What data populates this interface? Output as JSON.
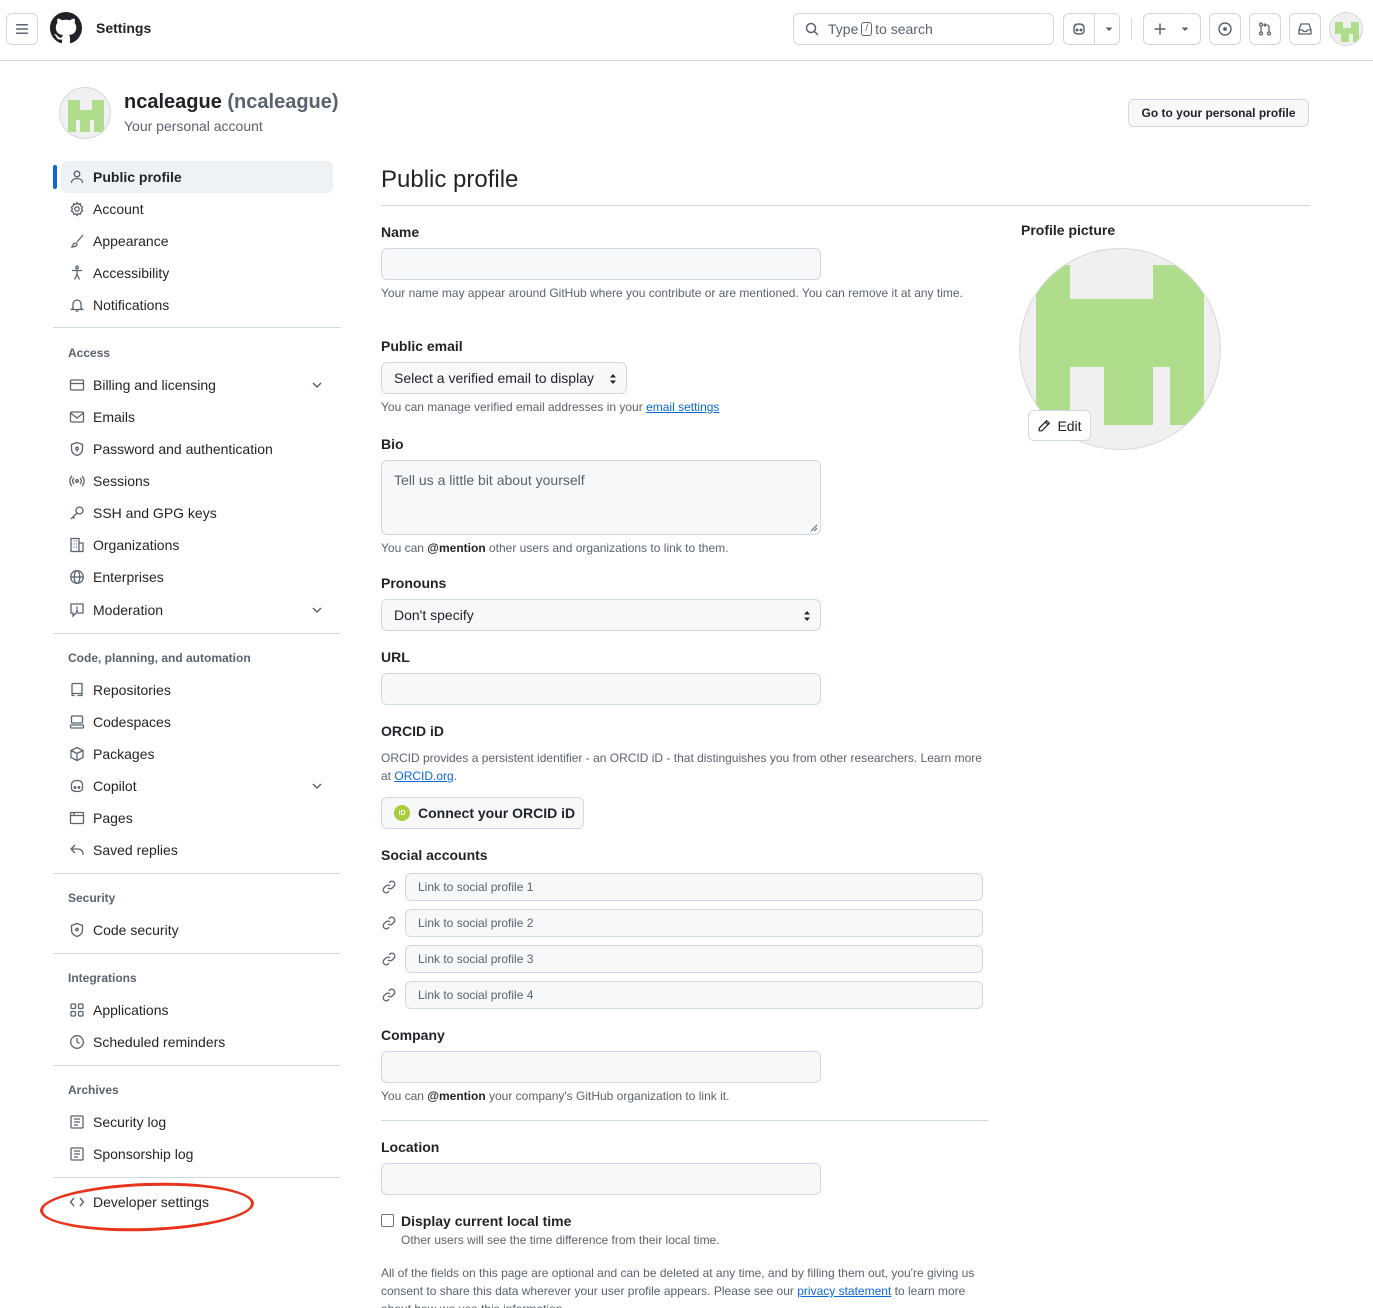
{
  "header": {
    "title": "Settings",
    "search_prefix": "Type",
    "search_key": "/",
    "search_suffix": "to search"
  },
  "account": {
    "name": "ncaleague",
    "handle": "(ncaleague)",
    "subtitle": "Your personal account",
    "profile_button": "Go to your personal profile"
  },
  "sidebar": {
    "top": [
      {
        "label": "Public profile",
        "icon": "person-icon",
        "active": true
      },
      {
        "label": "Account",
        "icon": "gear-icon"
      },
      {
        "label": "Appearance",
        "icon": "paintbrush-icon"
      },
      {
        "label": "Accessibility",
        "icon": "accessibility-icon"
      },
      {
        "label": "Notifications",
        "icon": "bell-icon"
      }
    ],
    "access_heading": "Access",
    "access": [
      {
        "label": "Billing and licensing",
        "icon": "credit-card-icon",
        "expandable": true
      },
      {
        "label": "Emails",
        "icon": "mail-icon"
      },
      {
        "label": "Password and authentication",
        "icon": "shield-lock-icon"
      },
      {
        "label": "Sessions",
        "icon": "broadcast-icon"
      },
      {
        "label": "SSH and GPG keys",
        "icon": "key-icon"
      },
      {
        "label": "Organizations",
        "icon": "organization-icon"
      },
      {
        "label": "Enterprises",
        "icon": "globe-icon"
      },
      {
        "label": "Moderation",
        "icon": "report-icon",
        "expandable": true
      }
    ],
    "code_heading": "Code, planning, and automation",
    "code": [
      {
        "label": "Repositories",
        "icon": "repo-icon"
      },
      {
        "label": "Codespaces",
        "icon": "codespaces-icon"
      },
      {
        "label": "Packages",
        "icon": "package-icon"
      },
      {
        "label": "Copilot",
        "icon": "copilot-icon",
        "expandable": true
      },
      {
        "label": "Pages",
        "icon": "browser-icon"
      },
      {
        "label": "Saved replies",
        "icon": "reply-icon"
      }
    ],
    "security_heading": "Security",
    "security": [
      {
        "label": "Code security",
        "icon": "shield-icon"
      }
    ],
    "integrations_heading": "Integrations",
    "integrations": [
      {
        "label": "Applications",
        "icon": "apps-icon"
      },
      {
        "label": "Scheduled reminders",
        "icon": "clock-icon"
      }
    ],
    "archives_heading": "Archives",
    "archives": [
      {
        "label": "Security log",
        "icon": "log-icon"
      },
      {
        "label": "Sponsorship log",
        "icon": "log-icon"
      }
    ],
    "developer": {
      "label": "Developer settings",
      "icon": "code-icon"
    }
  },
  "main": {
    "title": "Public profile",
    "name_label": "Name",
    "name_value": "",
    "name_note": "Your name may appear around GitHub where you contribute or are mentioned. You can remove it at any time.",
    "email_label": "Public email",
    "email_select": "Select a verified email to display",
    "email_note_prefix": "You can manage verified email addresses in your",
    "email_note_link": "email settings",
    "bio_label": "Bio",
    "bio_placeholder": "Tell us a little bit about yourself",
    "bio_note_prefix": "You can",
    "bio_note_mention": "@mention",
    "bio_note_suffix": "other users and organizations to link to them.",
    "pronouns_label": "Pronouns",
    "pronouns_select": "Don't specify",
    "url_label": "URL",
    "orcid_label": "ORCID iD",
    "orcid_note_prefix": "ORCID provides a persistent identifier - an ORCID iD - that distinguishes you from other researchers. Learn more at",
    "orcid_note_link": "ORCID.org",
    "orcid_note_suffix": ".",
    "orcid_button": "Connect your ORCID iD",
    "orcid_badge": "iD",
    "social_label": "Social accounts",
    "social_placeholders": [
      "Link to social profile 1",
      "Link to social profile 2",
      "Link to social profile 3",
      "Link to social profile 4"
    ],
    "company_label": "Company",
    "company_note_prefix": "You can",
    "company_note_mention": "@mention",
    "company_note_suffix": "your company's GitHub organization to link it.",
    "location_label": "Location",
    "localtime_label": "Display current local time",
    "localtime_note": "Other users will see the time difference from their local time.",
    "footer_note_prefix": "All of the fields on this page are optional and can be deleted at any time, and by filling them out, you're giving us consent to share this data wherever your user profile appears. Please see our",
    "footer_note_link": "privacy statement",
    "footer_note_suffix": "to learn more about how we use this information."
  },
  "profile_picture": {
    "label": "Profile picture",
    "edit_button": "Edit"
  },
  "colors": {
    "accent": "#0969da",
    "avatar_green": "#b0dd8c",
    "annotation_red": "#e8341c"
  }
}
